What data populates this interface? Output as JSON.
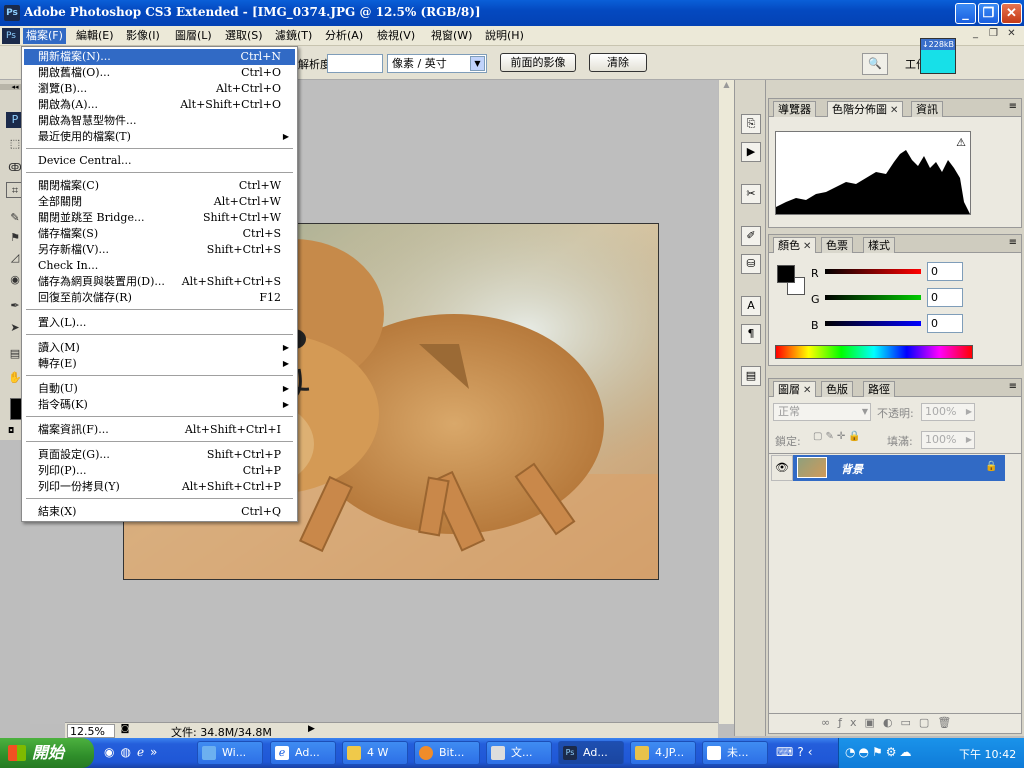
{
  "window": {
    "title": "Adobe Photoshop CS3 Extended - [IMG_0374.JPG @ 12.5% (RGB/8)]",
    "app_icon": "Ps",
    "minimize": "_",
    "restore": "❐",
    "close": "✕"
  },
  "menubar": {
    "items": [
      "檔案(F)",
      "編輯(E)",
      "影像(I)",
      "圖層(L)",
      "選取(S)",
      "濾鏡(T)",
      "分析(A)",
      "檢視(V)",
      "視窗(W)",
      "說明(H)"
    ]
  },
  "options": {
    "resolution_label": "解析度:",
    "resolution_value": "",
    "unit_select": "像素 / 英寸",
    "front_image_button": "前面的影像",
    "clear_button": "清除",
    "workspace_label": "工作區",
    "memory_badge": "↓228kB"
  },
  "file_menu": {
    "items": [
      {
        "label": "開新檔案(N)...",
        "shortcut": "Ctrl+N"
      },
      {
        "label": "開啟舊檔(O)...",
        "shortcut": "Ctrl+O"
      },
      {
        "label": "瀏覽(B)...",
        "shortcut": "Alt+Ctrl+O"
      },
      {
        "label": "開啟為(A)...",
        "shortcut": "Alt+Shift+Ctrl+O"
      },
      {
        "label": "開啟為智慧型物件...",
        "shortcut": ""
      },
      {
        "label": "最近使用的檔案(T)",
        "shortcut": ""
      },
      {
        "label": "Device Central...",
        "shortcut": ""
      },
      {
        "label": "關閉檔案(C)",
        "shortcut": "Ctrl+W"
      },
      {
        "label": "全部關閉",
        "shortcut": "Alt+Ctrl+W"
      },
      {
        "label": "關閉並跳至 Bridge...",
        "shortcut": "Shift+Ctrl+W"
      },
      {
        "label": "儲存檔案(S)",
        "shortcut": "Ctrl+S"
      },
      {
        "label": "另存新檔(V)...",
        "shortcut": "Shift+Ctrl+S"
      },
      {
        "label": "Check In...",
        "shortcut": ""
      },
      {
        "label": "儲存為網頁與裝置用(D)...",
        "shortcut": "Alt+Shift+Ctrl+S"
      },
      {
        "label": "回復至前次儲存(R)",
        "shortcut": "F12"
      },
      {
        "label": "置入(L)...",
        "shortcut": ""
      },
      {
        "label": "讀入(M)",
        "shortcut": ""
      },
      {
        "label": "轉存(E)",
        "shortcut": ""
      },
      {
        "label": "自動(U)",
        "shortcut": ""
      },
      {
        "label": "指令碼(K)",
        "shortcut": ""
      },
      {
        "label": "檔案資訊(F)...",
        "shortcut": "Alt+Shift+Ctrl+I"
      },
      {
        "label": "頁面設定(G)...",
        "shortcut": "Shift+Ctrl+P"
      },
      {
        "label": "列印(P)...",
        "shortcut": "Ctrl+P"
      },
      {
        "label": "列印一份拷貝(Y)",
        "shortcut": "Alt+Shift+Ctrl+P"
      },
      {
        "label": "結束(X)",
        "shortcut": "Ctrl+Q"
      }
    ]
  },
  "status": {
    "zoom": "12.5%",
    "doc_size": "文件: 34.8M/34.8M"
  },
  "panels": {
    "histogram_tabs": [
      "導覽器",
      "色階分佈圖",
      "資訊"
    ],
    "color_tabs": [
      "顏色",
      "色票",
      "樣式"
    ],
    "color": {
      "r_label": "R",
      "g_label": "G",
      "b_label": "B",
      "r": "0",
      "g": "0",
      "b": "0"
    },
    "layers_tabs": [
      "圖層",
      "色版",
      "路徑"
    ],
    "layers": {
      "blend_mode": "正常",
      "opacity_label": "不透明:",
      "opacity": "100%",
      "lock_label": "鎖定:",
      "fill_label": "填滿:",
      "fill": "100%",
      "layer_name": "背景"
    }
  },
  "taskbar": {
    "start": "開始",
    "tasks": [
      "Wi...",
      "Ad...",
      "4 W",
      "Bit...",
      "文...",
      "Ad...",
      "4.JP...",
      "未..."
    ],
    "clock": "下午 10:42"
  },
  "colors": {
    "accent": "#316ac5",
    "titlebar": "#0449c0",
    "layer_selected": "#316ac5"
  }
}
